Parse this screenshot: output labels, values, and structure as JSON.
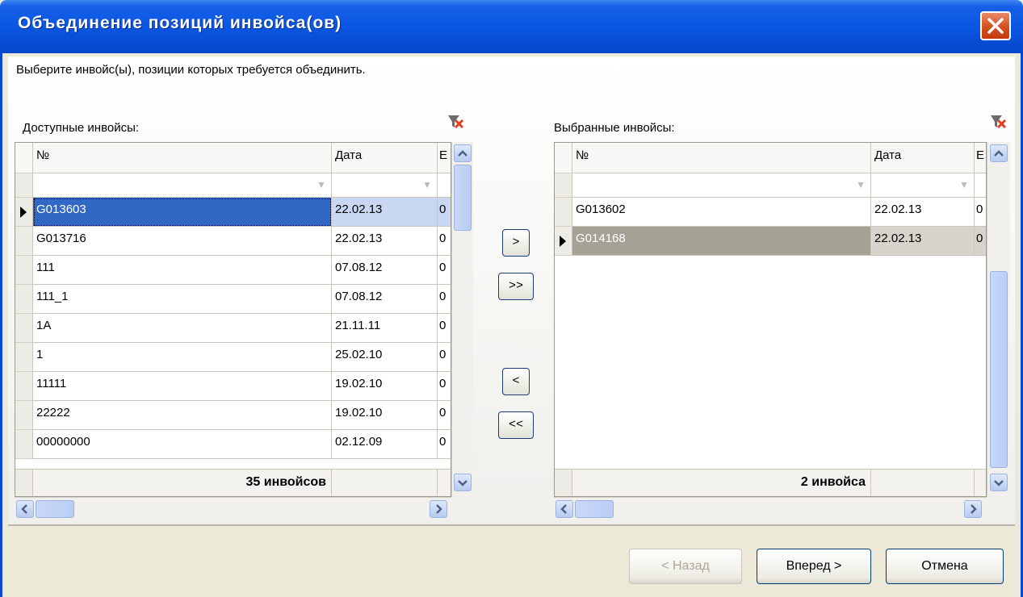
{
  "window": {
    "title": "Объединение позиций инвойса(ов)"
  },
  "instruction": "Выберите инвойс(ы), позиции которых требуется объединить.",
  "available": {
    "label": "Доступные инвойсы:",
    "columns": [
      "№",
      "Дата",
      "E"
    ],
    "rows": [
      {
        "num": "G013603",
        "date": "22.02.13",
        "extra": "0",
        "selected": true
      },
      {
        "num": "G013716",
        "date": "22.02.13",
        "extra": "0"
      },
      {
        "num": "111",
        "date": "07.08.12",
        "extra": "0"
      },
      {
        "num": "111_1",
        "date": "07.08.12",
        "extra": "0"
      },
      {
        "num": "1A",
        "date": "21.11.11",
        "extra": "0"
      },
      {
        "num": "1",
        "date": "25.02.10",
        "extra": "0"
      },
      {
        "num": "11111",
        "date": "19.02.10",
        "extra": "0"
      },
      {
        "num": "22222",
        "date": "19.02.10",
        "extra": "0"
      },
      {
        "num": "00000000",
        "date": "02.12.09",
        "extra": "0"
      }
    ],
    "footer_count": "35 инвойсов"
  },
  "selected": {
    "label": "Выбранные инвойсы:",
    "columns": [
      "№",
      "Дата",
      "E"
    ],
    "rows": [
      {
        "num": "G013602",
        "date": "22.02.13",
        "extra": "0"
      },
      {
        "num": "G014168",
        "date": "22.02.13",
        "extra": "0",
        "selected": true
      }
    ],
    "footer_count": "2 инвойса"
  },
  "move_buttons": {
    "add_one": ">",
    "add_all": ">>",
    "remove_one": "<",
    "remove_all": "<<"
  },
  "buttons": {
    "back": "< Назад",
    "next": "Вперед >",
    "cancel": "Отмена"
  }
}
